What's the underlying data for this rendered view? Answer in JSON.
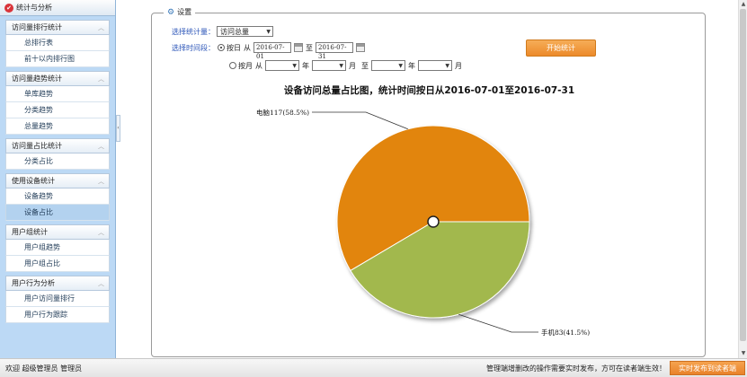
{
  "sidebar": {
    "title": "统计与分析",
    "groups": [
      {
        "label": "访问量排行统计",
        "items": [
          "总排行表",
          "前十以内排行图"
        ]
      },
      {
        "label": "访问量趋势统计",
        "items": [
          "单库趋势",
          "分类趋势",
          "总量趋势"
        ]
      },
      {
        "label": "访问量占比统计",
        "items": [
          "分类占比"
        ]
      },
      {
        "label": "使用设备统计",
        "items": [
          "设备趋势",
          "设备占比"
        ]
      },
      {
        "label": "用户组统计",
        "items": [
          "用户组趋势",
          "用户组占比"
        ]
      },
      {
        "label": "用户行为分析",
        "items": [
          "用户访问量排行",
          "用户行为跟踪"
        ]
      }
    ],
    "active_item": "设备占比"
  },
  "settings": {
    "legend": "设置",
    "metric_label": "选择统计量：",
    "metric_value": "访问总量",
    "period_label": "选择时间段：",
    "by_day_label": "按日",
    "from_label": "从",
    "start_date": "2016-07-01",
    "to_label": "至",
    "end_date": "2016-07-31",
    "by_month_label": "按月",
    "year_label": "年",
    "month_label": "月",
    "start_button": "开始统计"
  },
  "chart_data": {
    "type": "pie",
    "title": "设备访问总量占比图，统计时间按日从2016-07-01至2016-07-31",
    "slices": [
      {
        "name": "电脑",
        "value": 117,
        "percent": 58.5,
        "label": "电脑117(58.5%)",
        "color": "#e2850a"
      },
      {
        "name": "手机",
        "value": 83,
        "percent": 41.5,
        "label": "手机83(41.5%)",
        "color": "#a2b84d"
      }
    ]
  },
  "status": {
    "welcome": "欢迎  超级管理员 管理员",
    "notice": "管理端增删改的操作需要实时发布，方可在读者端生效！",
    "publish_button": "实时发布到读者端"
  }
}
